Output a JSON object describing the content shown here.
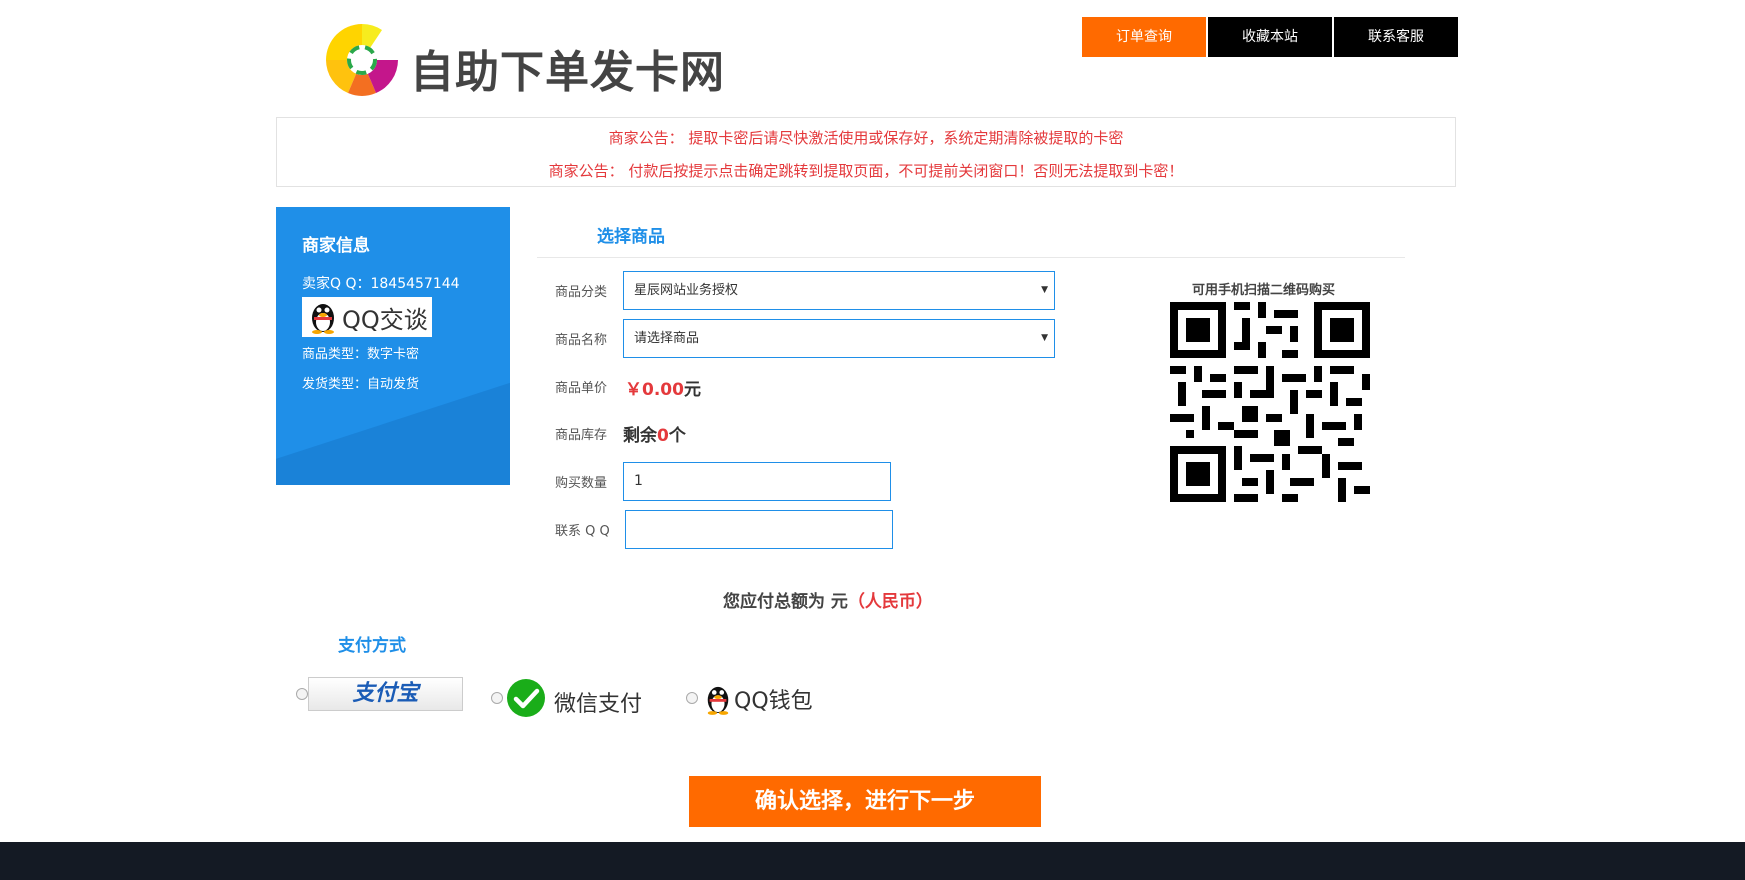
{
  "header": {
    "site_title": "自助下单发卡网",
    "nav": [
      "订单查询",
      "收藏本站",
      "联系客服"
    ]
  },
  "notices": [
    "商家公告： 提取卡密后请尽快激活使用或保存好，系统定期清除被提取的卡密",
    "商家公告： 付款后按提示点击确定跳转到提取页面，不可提前关闭窗口！否则无法提取到卡密！"
  ],
  "merchant": {
    "title": "商家信息",
    "qq_line": "卖家Q Q：1845457144",
    "qq_badge": "QQ交谈",
    "product_type": "商品类型：数字卡密",
    "ship_type": "发货类型：自动发货"
  },
  "form": {
    "section_title": "选择商品",
    "category_label": "商品分类",
    "category_value": "星辰网站业务授权",
    "name_label": "商品名称",
    "name_value": "请选择商品",
    "price_label": "商品单价",
    "price_value": "￥0.00",
    "price_unit": "元",
    "stock_label": "商品库存",
    "stock_prefix": "剩余",
    "stock_count": "0",
    "stock_suffix": "个",
    "qty_label": "购买数量",
    "qty_value": "1",
    "qq_label": "联系 Q Q",
    "qq_value": ""
  },
  "qr": {
    "title": "可用手机扫描二维码购买"
  },
  "total": {
    "label": "您应付总额为 元",
    "currency": "（人民币）"
  },
  "payment": {
    "title": "支付方式",
    "alipay": "支付宝",
    "wechat": "微信支付",
    "qqwallet": "QQ钱包"
  },
  "confirm_label": "确认选择，进行下一步",
  "colors": {
    "accent": "#ff6a00",
    "blue": "#1f8fe8",
    "red": "#e4393c",
    "footer": "#141a24"
  }
}
